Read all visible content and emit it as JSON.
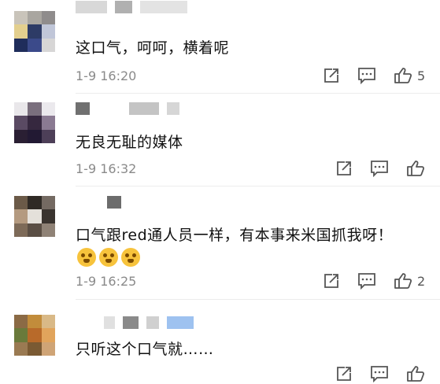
{
  "comments": [
    {
      "text": "这口气，呵呵，横着呢",
      "time": "1-9 16:20",
      "likes": "5",
      "avatar": [
        "#c9c4ba",
        "#a9a6a0",
        "#8f8c8c",
        "#e3cf8e",
        "#2d3b66",
        "#c0c6d8",
        "#1f2d5b",
        "#3b4a8a",
        "#d7d6d6"
      ]
    },
    {
      "text": "无良无耻的媒体",
      "time": "1-9 16:32",
      "likes": "",
      "avatar": [
        "#e9e7ea",
        "#7a6f7d",
        "#ebe9ed",
        "#5a4a63",
        "#36283f",
        "#8a7a92",
        "#2a1f33",
        "#221933",
        "#4d3f58"
      ]
    },
    {
      "text": "口气跟red通人员一样，有本事来米国抓我呀！",
      "time": "1-9 16:25",
      "likes": "2",
      "avatar": [
        "#6b5a48",
        "#2f2a25",
        "#746a62",
        "#b49a80",
        "#e4e0da",
        "#3a342f",
        "#7d6a58",
        "#5a4e44",
        "#8f8276"
      ]
    },
    {
      "text": "只听这个口气就……",
      "time": "",
      "likes": "",
      "avatar": [
        "#8b6a45",
        "#c28c3b",
        "#d9b987",
        "#6a7a3b",
        "#b86a2a",
        "#e1a45c",
        "#9a7a52",
        "#7a5a33",
        "#cfa476"
      ]
    }
  ]
}
